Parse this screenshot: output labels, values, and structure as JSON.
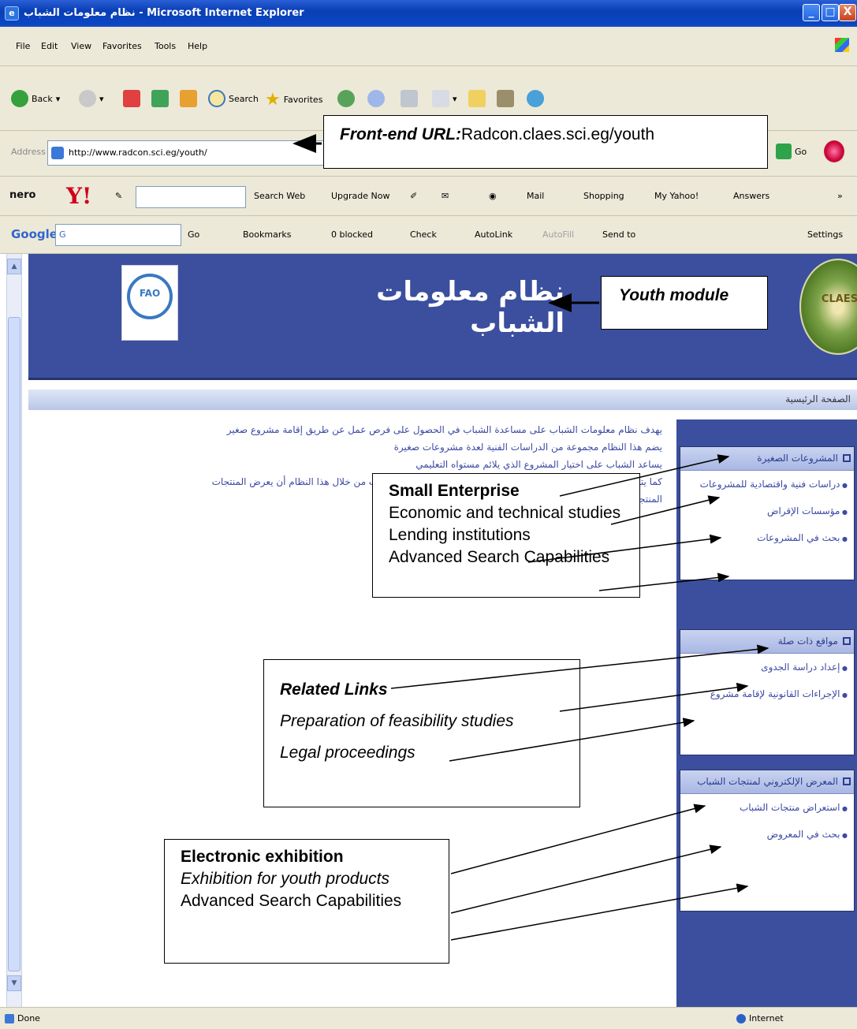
{
  "window": {
    "title": "نظام معلومات الشباب - Microsoft Internet Explorer",
    "buttons": {
      "minimize": "_",
      "maximize": "□",
      "close": "X"
    }
  },
  "menubar": {
    "items": [
      "File",
      "Edit",
      "View",
      "Favorites",
      "Tools",
      "Help"
    ]
  },
  "toolbar": {
    "back": "Back",
    "search": "Search",
    "favorites": "Favorites"
  },
  "address": {
    "label": "Address",
    "url": "http://www.radcon.sci.eg/youth/",
    "go": "Go"
  },
  "yahoo": {
    "nero": "nero",
    "logo": "Y!",
    "search_web": "Search Web",
    "upgrade": "Upgrade Now",
    "mail": "Mail",
    "shopping": "Shopping",
    "my_yahoo": "My Yahoo!",
    "answers": "Answers"
  },
  "google": {
    "logo": "Google",
    "search_value": "G",
    "go": "Go",
    "bookmarks": "Bookmarks",
    "blocked": "0 blocked",
    "check": "Check",
    "autolink": "AutoLink",
    "autofill": "AutoFill",
    "send_to": "Send to",
    "settings": "Settings"
  },
  "banner": {
    "title": "نظام معلومات الشباب",
    "fao_text": "FAO",
    "claes_text": "CLAES"
  },
  "breadcrumb": "الصفحة الرئيسية",
  "intro": {
    "lines": [
      "يهدف نظام معلومات الشباب على مساعدة الشباب في الحصول على فرص عمل عن طريق إقامة مشروع صغير",
      "يضم هذا النظام مجموعة من الدراسات الفنية لعدة مشروعات صغيرة",
      "يساعد الشباب على اختيار المشروع الذي يلائم مستواه التعليمي",
      "كما يتيح النظام معرفة مؤسسات الإقراض ومقاومة الصغر . يستطيع الشباب من خلال هذا النظام أن يعرض المنتجات",
      "المنتجات لمن أراد أن يشتريها"
    ]
  },
  "sidebar": {
    "sections": [
      {
        "title": "المشروعات الصغيرة",
        "links": [
          "دراسات فنية واقتصادية للمشروعات",
          "مؤسسات الإقراض",
          "بحث في المشروعات"
        ]
      },
      {
        "title": "مواقع ذات صلة",
        "links": [
          "إعداد دراسة الجدوى",
          "الإجراءات القانونية لإقامة مشروع"
        ]
      },
      {
        "title": "المعرض الإلكتروني لمنتجات الشباب",
        "links": [
          "استعراض منتجات الشباب",
          "بحث في المعروض"
        ]
      }
    ]
  },
  "callouts": {
    "url": {
      "label": "Front-end URL:",
      "value": "Radcon.claes.sci.eg/youth"
    },
    "youth": {
      "label": "Youth module"
    },
    "small": {
      "title": "Small Enterprise",
      "line1": "Economic and technical studies",
      "line2": "Lending institutions",
      "line3": "Advanced Search Capabilities"
    },
    "related": {
      "title": "Related Links",
      "line1": "Preparation of feasibility studies",
      "line2": "Legal proceedings"
    },
    "exhibition": {
      "title": "Electronic exhibition",
      "line1": "Exhibition for youth products",
      "line2": "Advanced Search Capabilities"
    }
  },
  "status": {
    "text": "Done",
    "zone": "Internet"
  },
  "colors": {
    "banner": "#3b4f9e",
    "titlebar": "#0a3fb5",
    "link": "#3d4aa4"
  }
}
